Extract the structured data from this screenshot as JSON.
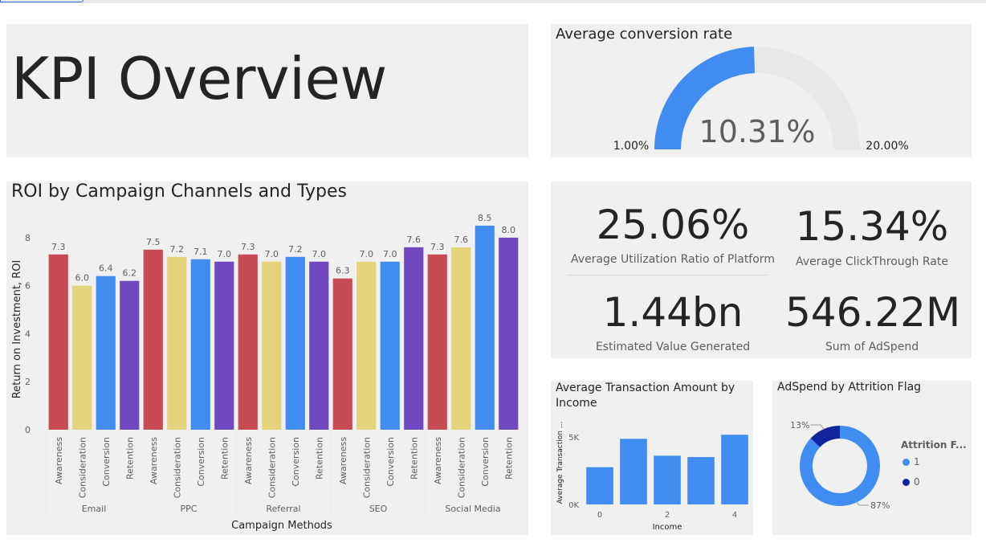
{
  "title": "KPI Overview",
  "gauge": {
    "title": "Average conversion rate",
    "value_label": "10.31%",
    "value": 10.31,
    "min_label": "1.00%",
    "max_label": "20.00%",
    "min": 1.0,
    "max": 20.0,
    "fill_color": "#418cf0",
    "track_color": "#e8e8e8"
  },
  "kpis": {
    "utilization": {
      "value": "25.06%",
      "label": "Average Utilization Ratio of Platform"
    },
    "clickthrough": {
      "value": "15.34%",
      "label": "Average ClickThrough Rate"
    },
    "value_generated": {
      "value": "1.44bn",
      "label": "Estimated Value Generated"
    },
    "adspend": {
      "value": "546.22M",
      "label": "Sum of AdSpend"
    }
  },
  "roi_title": "ROI by Campaign Channels and Types",
  "txn_title": "Average Transaction Amount by Income",
  "donut_title": "AdSpend by Attrition Flag",
  "chart_data": [
    {
      "type": "bar",
      "title": "ROI by Campaign Channels and Types",
      "xlabel": "Campaign Methods",
      "ylabel": "Return on Investment, ROI",
      "ylim": [
        0,
        9
      ],
      "yticks": [
        "0",
        "2",
        "4",
        "6",
        "8"
      ],
      "groups": [
        "Email",
        "PPC",
        "Referral",
        "SEO",
        "Social Media"
      ],
      "types": [
        "Awareness",
        "Consideration",
        "Conversion",
        "Retention"
      ],
      "type_colors": [
        "#c84b54",
        "#e3d37a",
        "#418cf0",
        "#7048c0"
      ],
      "values": [
        [
          7.3,
          6.0,
          6.4,
          6.2
        ],
        [
          7.5,
          7.2,
          7.1,
          7.0
        ],
        [
          7.3,
          7.0,
          7.2,
          7.0
        ],
        [
          6.3,
          7.0,
          7.0,
          7.6
        ],
        [
          7.3,
          7.6,
          8.5,
          8.0
        ]
      ],
      "data_labels": [
        [
          "7.3",
          "6.0",
          "6.4",
          "6.2"
        ],
        [
          "7.5",
          "7.2",
          "7.1",
          "7.0"
        ],
        [
          "7.3",
          "7.0",
          "7.2",
          "7.0"
        ],
        [
          "6.3",
          "7.0",
          "7.0",
          "7.6"
        ],
        [
          "7.3",
          "7.6",
          "8.5",
          "8.0"
        ]
      ],
      "grid": false
    },
    {
      "type": "bar",
      "title": "Average Transaction Amount by Income",
      "xlabel": "Income",
      "ylabel": "Average Transaction ...",
      "categories": [
        0,
        1,
        2,
        3,
        4
      ],
      "xtick_labels": [
        "0",
        "2",
        "4"
      ],
      "xtick_values": [
        0,
        2,
        4
      ],
      "values": [
        2750,
        4850,
        3600,
        3500,
        5150
      ],
      "ylim": [
        0,
        5700
      ],
      "yticks": [
        {
          "label": "0K",
          "value": 0
        },
        {
          "label": "5K",
          "value": 5000
        }
      ],
      "color": "#418cf0"
    },
    {
      "type": "pie",
      "title": "AdSpend by Attrition Flag",
      "legend_title": "Attrition F...",
      "labels": [
        "1",
        "0"
      ],
      "values": [
        87,
        13
      ],
      "slice_labels": [
        "87%",
        "13%"
      ],
      "colors": [
        "#418cf0",
        "#12239e"
      ],
      "legend": "right"
    }
  ]
}
